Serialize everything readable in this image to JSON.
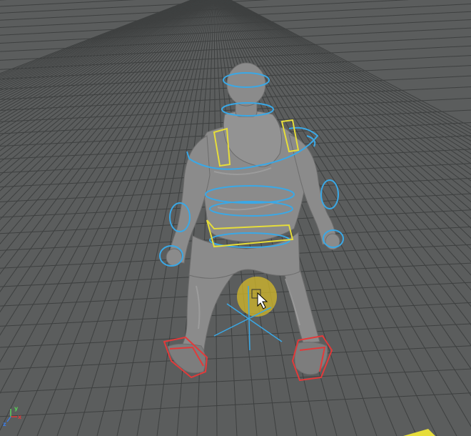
{
  "viewport": {
    "background": "#5b5d5d",
    "grid_color": "#3f4141",
    "character_color": "#8d8d8d",
    "control_colors": {
      "fk": "#3aa8e6",
      "spine": "#e6dd3a",
      "ik_foot": "#e23a3a"
    },
    "axis_labels": {
      "y": "y",
      "x": "x",
      "z": "z"
    },
    "axis_colors": {
      "x": "#e23a3a",
      "y": "#5ad05a",
      "z": "#3a7be6"
    },
    "manipulator_color": "#d4b92a",
    "cursor": "arrow"
  }
}
